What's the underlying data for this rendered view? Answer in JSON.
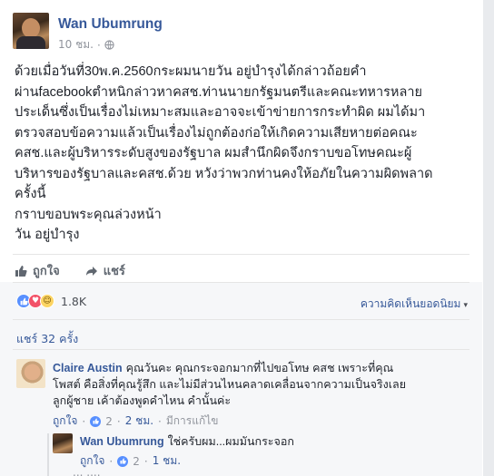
{
  "post": {
    "author": "Wan Ubumrung",
    "time": "10 ชม.",
    "separator": "·",
    "privacy_icon": "globe-icon",
    "lines": [
      "ด้วยเมื่อวันที่30พ.ค.2560กระผมนายวัน อยู่บำรุงได้กล่าวถ้อยคำ",
      "ผ่านfacebookตำหนิกล่าวหาคสช.ท่านนายกรัฐมนตรีและคณะทหารหลาย",
      "ประเด็นซึ่งเป็นเรื่องไม่เหมาะสมและอาจจะเข้าข่ายการกระทำผิด ผมได้มา",
      "ตรวจสอบข้อความแล้วเป็นเรื่องไม่ถูกต้องก่อให้เกิดความเสียหายต่อคณะ",
      "คสช.และผู้บริหารระดับสูงของรัฐบาล ผมสำนึกผิดจึงกราบขอโทษคณะผู้",
      "บริหารของรัฐบาลและคสช.ด้วย หวังว่าพวกท่านคงให้อภัยในความผิดพลาด",
      "ครั้งนี้",
      "กราบขอบพระคุณล่วงหน้า",
      "วัน อยู่บำรุง"
    ]
  },
  "actions": {
    "like_label": "ถูกใจ",
    "share_label": "แชร์"
  },
  "summary": {
    "reaction_count": "1.8K",
    "reactions": [
      "like",
      "love",
      "haha"
    ],
    "top_comments_label": "ความคิดเห็นยอดนิยม",
    "shares_label": "แชร์ 32 ครั้ง"
  },
  "comments": [
    {
      "name": "Claire Austin",
      "line1": "คุณวันคะ คุณกระจอกมากที่ไปขอโทษ คสช เพราะที่คุณ",
      "line2": "โพสต์ คือสิ่งที่คุณรู้สึก และไม่มีส่วนไหนคลาดเคลื่อนจากความเป็นจริงเลย",
      "line3": "ลูกผู้ชาย เค้าต้องพูดคำไหน คำนั้นค่ะ",
      "like_label": "ถูกใจ",
      "reply_count": "2",
      "time": "2 ชม.",
      "edited": "มีการแก้ไข"
    },
    {
      "name": "Wan Ubumrung",
      "text": "ใช่ครับผม...ผมมันกระจอก",
      "like_label": "ถูกใจ",
      "like_count": "2",
      "time": "1 ชม."
    }
  ],
  "partial_next": "... ...."
}
